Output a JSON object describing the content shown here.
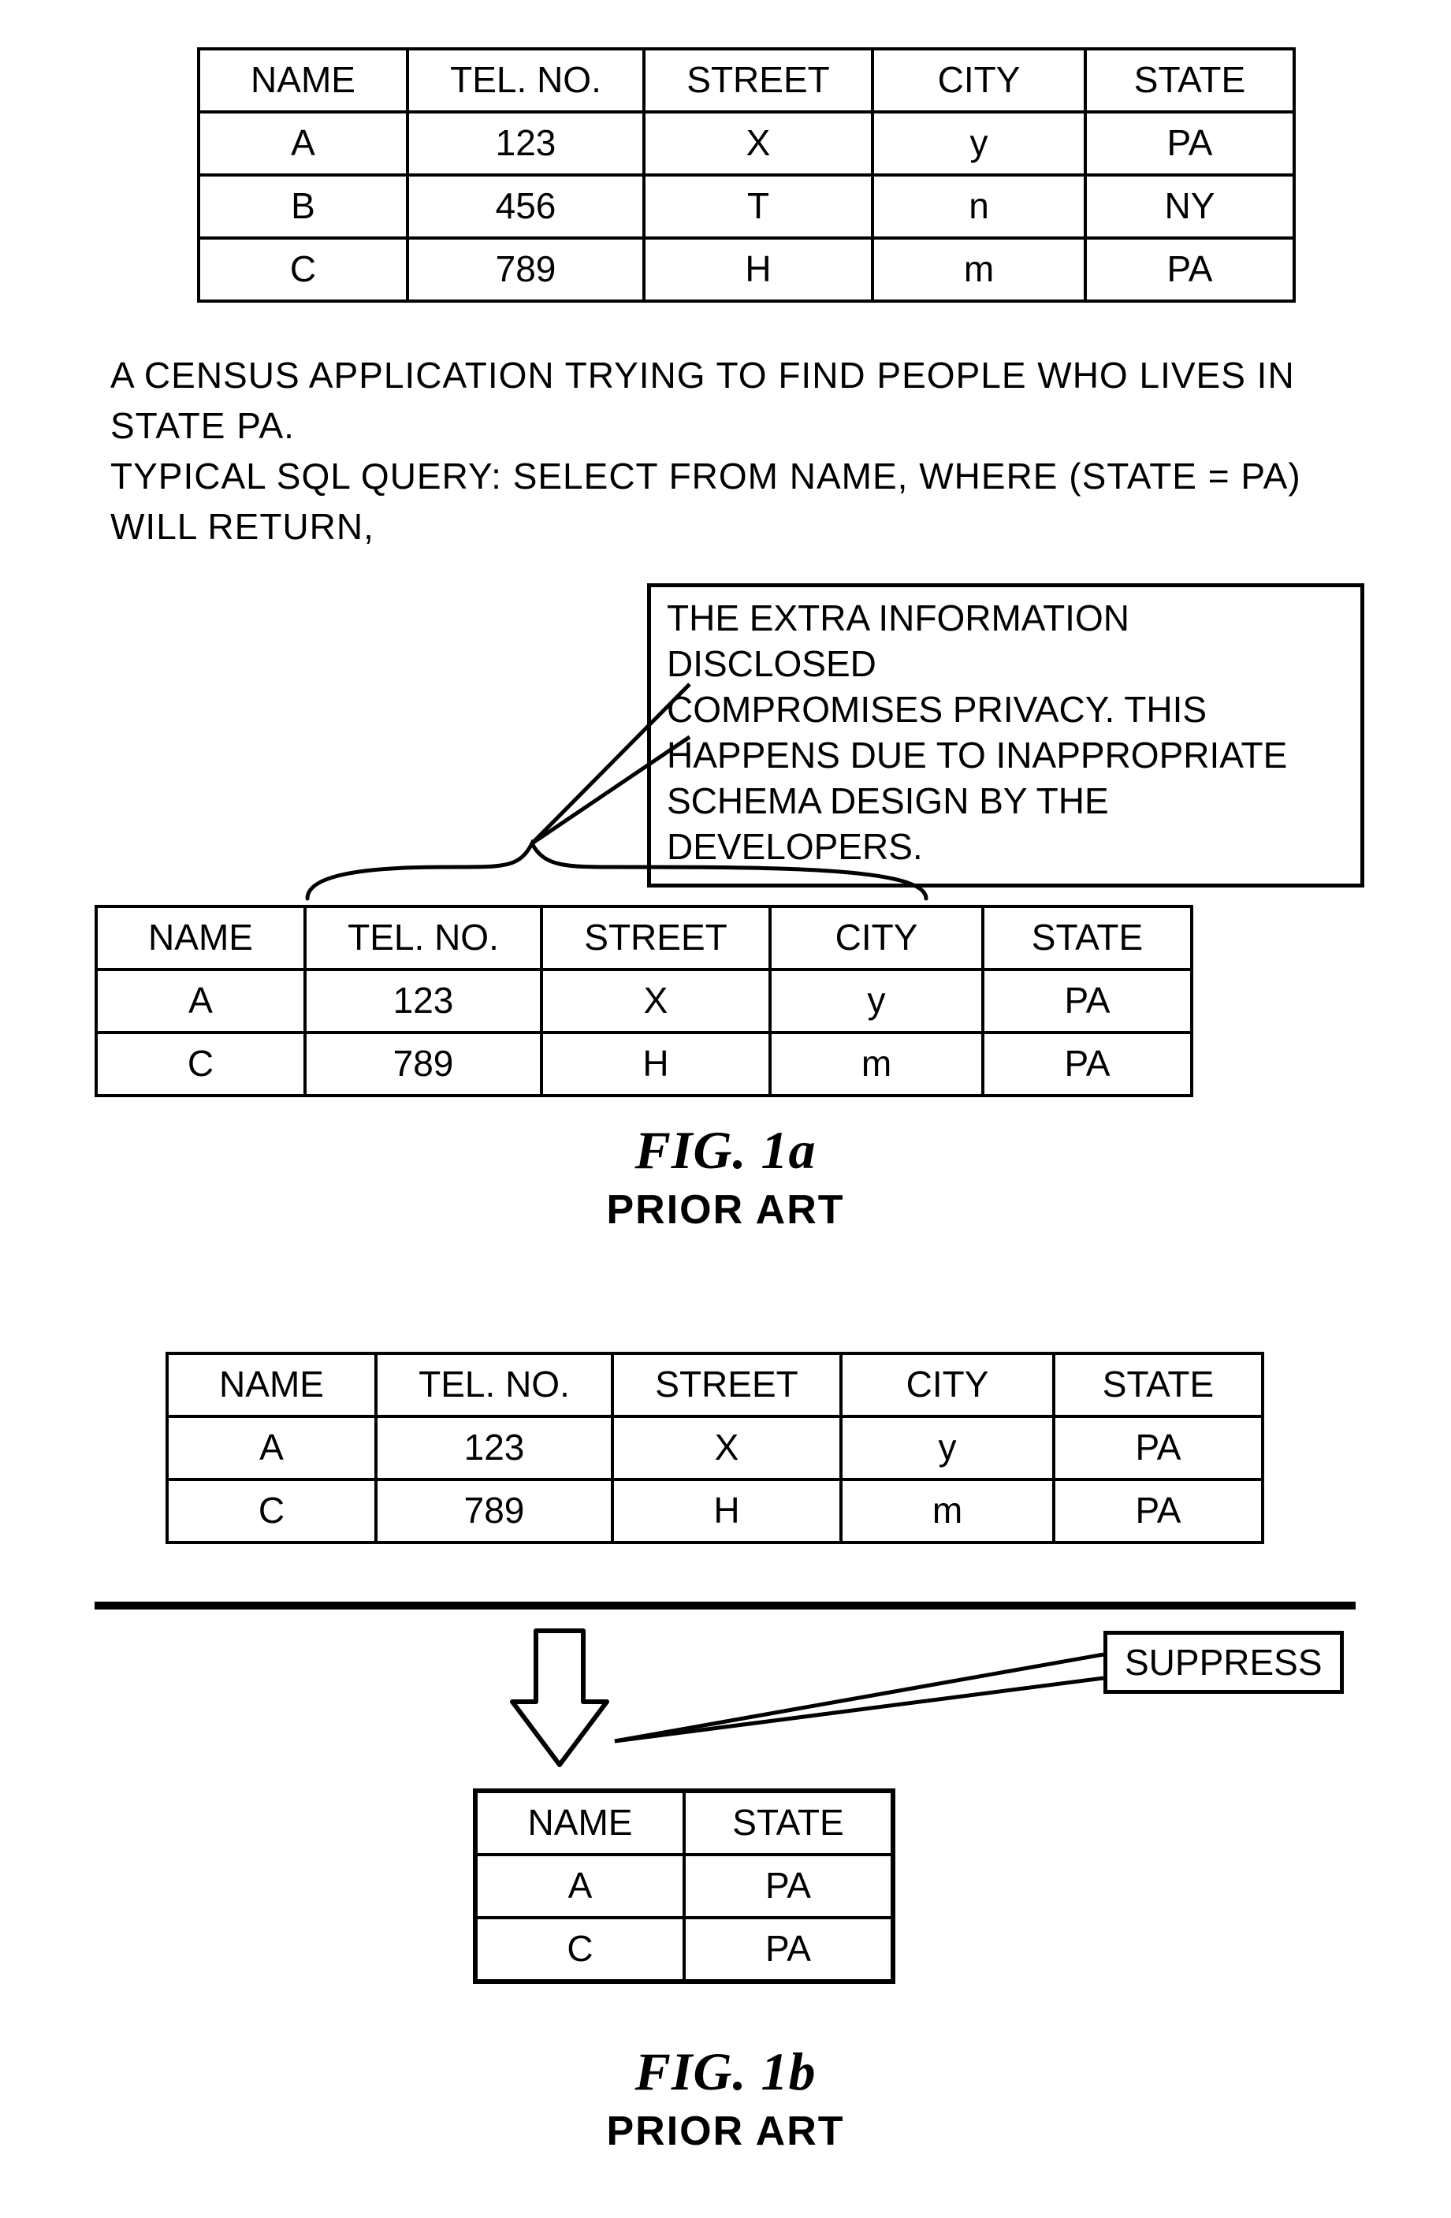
{
  "columns": [
    "NAME",
    "TEL. NO.",
    "STREET",
    "CITY",
    "STATE"
  ],
  "fig1a": {
    "table_full": {
      "rows": [
        [
          "A",
          "123",
          "X",
          "y",
          "PA"
        ],
        [
          "B",
          "456",
          "T",
          "n",
          "NY"
        ],
        [
          "C",
          "789",
          "H",
          "m",
          "PA"
        ]
      ]
    },
    "description_line1": "A CENSUS APPLICATION TRYING TO FIND PEOPLE WHO LIVES IN STATE PA.",
    "description_line2": "TYPICAL SQL QUERY: SELECT FROM NAME, WHERE (STATE = PA) WILL RETURN,",
    "callout_line1": "THE EXTRA INFORMATION DISCLOSED",
    "callout_line2": "COMPROMISES PRIVACY. THIS",
    "callout_line3": "HAPPENS DUE TO INAPPROPRIATE",
    "callout_line4": "SCHEMA DESIGN BY THE DEVELOPERS.",
    "table_result": {
      "rows": [
        [
          "A",
          "123",
          "X",
          "y",
          "PA"
        ],
        [
          "C",
          "789",
          "H",
          "m",
          "PA"
        ]
      ]
    },
    "caption_title": "FIG. 1a",
    "caption_sub": "PRIOR ART"
  },
  "fig1b": {
    "table_input": {
      "rows": [
        [
          "A",
          "123",
          "X",
          "y",
          "PA"
        ],
        [
          "C",
          "789",
          "H",
          "m",
          "PA"
        ]
      ]
    },
    "suppress_label": "SUPPRESS",
    "table_output": {
      "columns": [
        "NAME",
        "STATE"
      ],
      "rows": [
        [
          "A",
          "PA"
        ],
        [
          "C",
          "PA"
        ]
      ]
    },
    "caption_title": "FIG. 1b",
    "caption_sub": "PRIOR ART"
  }
}
